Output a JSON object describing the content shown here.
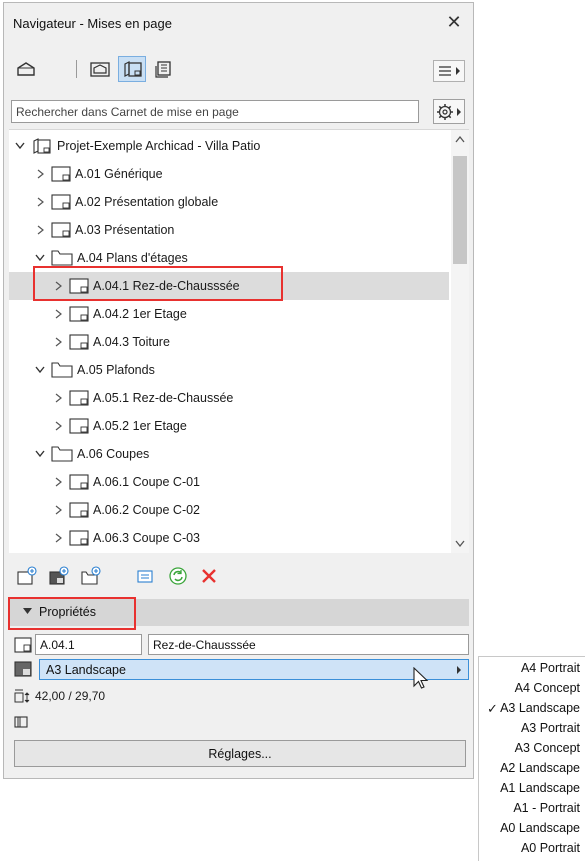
{
  "window": {
    "title": "Navigateur - Mises en page",
    "close_symbol": "✕"
  },
  "toolbar": {
    "buttons": [
      {
        "icon": "project-map-icon",
        "active": false
      },
      {
        "icon": "view-map-icon",
        "active": false
      },
      {
        "icon": "layout-book-icon",
        "active": true
      },
      {
        "icon": "publisher-sets-icon",
        "active": false
      }
    ],
    "menu_icon": "hamburger-menu-icon"
  },
  "search": {
    "placeholder": "Rechercher dans Carnet de mise en page",
    "value": ""
  },
  "tree": {
    "root": {
      "label": "Projet-Exemple Archicad - Villa Patio",
      "expanded": true
    },
    "items": [
      {
        "label": "A.01 Générique",
        "type": "layout",
        "level": 1,
        "expanded": false
      },
      {
        "label": "A.02 Présentation globale",
        "type": "layout",
        "level": 1,
        "expanded": false
      },
      {
        "label": "A.03 Présentation",
        "type": "layout",
        "level": 1,
        "expanded": false
      },
      {
        "label": "A.04 Plans d'étages",
        "type": "folder",
        "level": 1,
        "expanded": true
      },
      {
        "label": "A.04.1 Rez-de-Chausssée",
        "type": "layout",
        "level": 2,
        "expanded": false,
        "selected": true
      },
      {
        "label": "A.04.2 1er Etage",
        "type": "layout",
        "level": 2,
        "expanded": false
      },
      {
        "label": "A.04.3 Toiture",
        "type": "layout",
        "level": 2,
        "expanded": false
      },
      {
        "label": "A.05 Plafonds",
        "type": "folder",
        "level": 1,
        "expanded": true
      },
      {
        "label": "A.05.1 Rez-de-Chaussée",
        "type": "layout",
        "level": 2,
        "expanded": false
      },
      {
        "label": "A.05.2 1er Etage",
        "type": "layout",
        "level": 2,
        "expanded": false
      },
      {
        "label": "A.06 Coupes",
        "type": "folder",
        "level": 1,
        "expanded": true
      },
      {
        "label": "A.06.1 Coupe C-01",
        "type": "layout",
        "level": 2,
        "expanded": false
      },
      {
        "label": "A.06.2 Coupe C-02",
        "type": "layout",
        "level": 2,
        "expanded": false
      },
      {
        "label": "A.06.3 Coupe C-03",
        "type": "layout",
        "level": 2,
        "expanded": false
      }
    ]
  },
  "actions": [
    {
      "icon": "new-layout-icon"
    },
    {
      "icon": "new-master-layout-icon"
    },
    {
      "icon": "new-subset-icon"
    },
    {
      "icon": "properties-list-icon"
    },
    {
      "icon": "update-icon"
    },
    {
      "icon": "delete-icon"
    }
  ],
  "properties": {
    "header": "Propriétés",
    "id_value": "A.04.1",
    "name_value": "Rez-de-Chausssée",
    "master_layout": "A3 Landscape",
    "size": "42,00 / 29,70"
  },
  "settings_button": "Réglages...",
  "master_dropdown": {
    "options": [
      "A4 Portrait",
      "A4 Concept",
      "A3 Landscape",
      "A3 Portrait",
      "A3 Concept",
      "A2 Landscape",
      "A1 Landscape",
      "A1 - Portrait",
      "A0 Landscape",
      "A0 Portrait"
    ],
    "selected_index": 2,
    "check_symbol": "✓"
  },
  "colors": {
    "highlight_border": "#e8312f",
    "active_tool": "#c9dff4",
    "selected_row": "#dcdcdc",
    "select_field": "#cfe3f7"
  }
}
